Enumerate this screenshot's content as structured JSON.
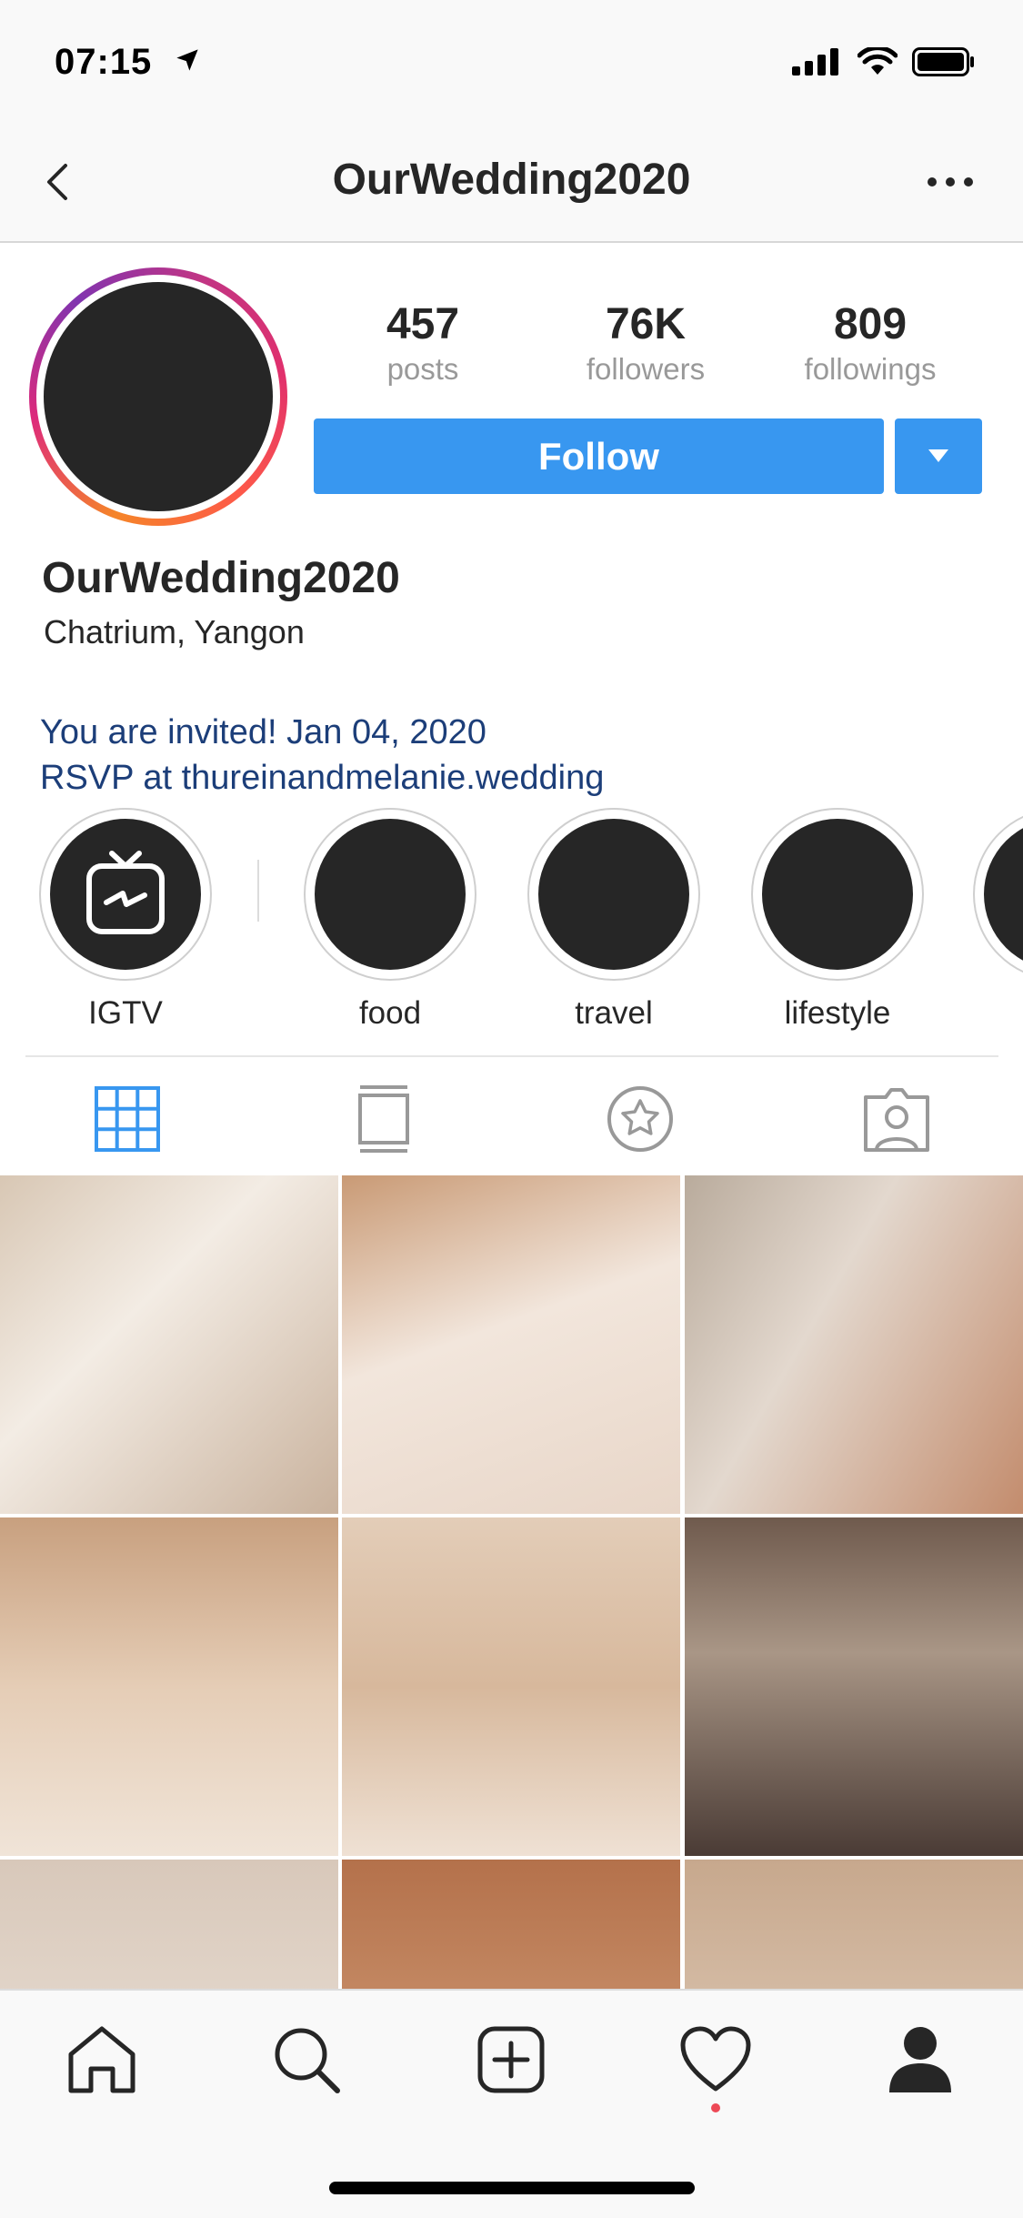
{
  "status_bar": {
    "time": "07:15"
  },
  "header": {
    "title": "OurWedding2020"
  },
  "profile": {
    "stats": [
      {
        "value": "457",
        "label": "posts"
      },
      {
        "value": "76K",
        "label": "followers"
      },
      {
        "value": "809",
        "label": "followings"
      }
    ],
    "follow_label": "Follow",
    "name": "OurWedding2020",
    "location": "Chatrium, Yangon",
    "bio_lines": [
      "You are invited! Jan 04, 2020",
      "RSVP at thureinandmelanie.wedding"
    ]
  },
  "highlights": [
    {
      "label": "IGTV",
      "icon": "igtv-icon"
    },
    {
      "label": "food"
    },
    {
      "label": "travel"
    },
    {
      "label": "lifestyle"
    }
  ],
  "tabs": [
    "grid-icon",
    "reels-icon",
    "tagged-star-icon",
    "tagged-person-icon"
  ],
  "bottom_nav": [
    "home-icon",
    "search-icon",
    "add-post-icon",
    "heart-icon",
    "profile-icon"
  ],
  "colors": {
    "follow_button": "#3897f0",
    "bio_link": "#1c3e79",
    "active_tab": "#3897f0"
  }
}
